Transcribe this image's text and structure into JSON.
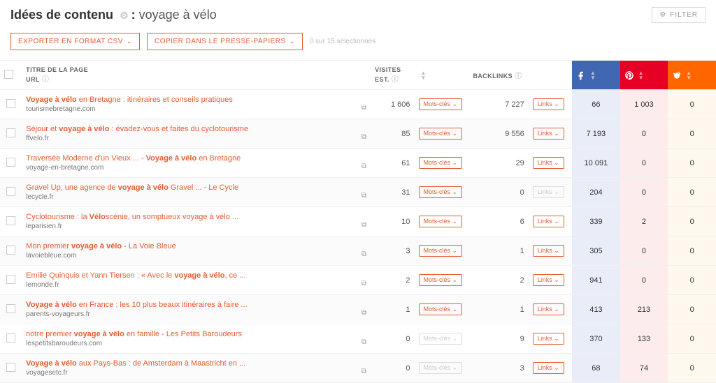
{
  "header": {
    "title_prefix": "Idées de contenu",
    "title_kw": "voyage à vélo",
    "filter": "FILTER"
  },
  "actions": {
    "export": "EXPORTER EN FORMAT CSV",
    "copy": "COPIER DANS LE PRESSE-PAPIERS",
    "selected": "0 sur 15 sélectionnés"
  },
  "columns": {
    "title": "TITRE DE LA PAGE",
    "url": "URL",
    "visits": "VISITES EST.",
    "backlinks": "BACKLINKS"
  },
  "pill": {
    "keywords": "Mots-clés",
    "links": "Links"
  },
  "rows": [
    {
      "title_pre": "",
      "title_b": "Voyage à vélo",
      "title_post": " en Bretagne : itinéraires et conseils pratiques",
      "url": "tourismebretagne.com",
      "visits": "1 606",
      "kw_enabled": true,
      "backlinks": "7 227",
      "lk_enabled": true,
      "fb": "66",
      "pt": "1 003",
      "rd": "0"
    },
    {
      "title_pre": "Séjour et ",
      "title_b": "voyage à vélo",
      "title_post": " : évadez-vous et faites du cyclotourisme",
      "url": "ffvelo.fr",
      "visits": "85",
      "kw_enabled": true,
      "backlinks": "9 556",
      "lk_enabled": true,
      "fb": "7 193",
      "pt": "0",
      "rd": "0"
    },
    {
      "title_pre": "Traversée Moderne d'un Vieux ... - ",
      "title_b": "Voyage à vélo",
      "title_post": " en Bretagne",
      "url": "voyage-en-bretagne.com",
      "visits": "61",
      "kw_enabled": true,
      "backlinks": "29",
      "lk_enabled": true,
      "fb": "10 091",
      "pt": "0",
      "rd": "0"
    },
    {
      "title_pre": "Gravel Up, une agence de ",
      "title_b": "voyage à vélo",
      "title_post": " Gravel ... - Le Cycle",
      "url": "lecycle.fr",
      "visits": "31",
      "kw_enabled": true,
      "backlinks": "0",
      "lk_enabled": false,
      "fb": "204",
      "pt": "0",
      "rd": "0"
    },
    {
      "title_pre": "Cyclotourisme : la ",
      "title_b": "Vélo",
      "title_post": "scénie, un somptueux voyage à vélo ...",
      "url": "leparisien.fr",
      "visits": "10",
      "kw_enabled": true,
      "backlinks": "6",
      "lk_enabled": true,
      "fb": "339",
      "pt": "2",
      "rd": "0"
    },
    {
      "title_pre": "Mon premier ",
      "title_b": "voyage à vélo",
      "title_post": " - La Voie Bleue",
      "url": "lavoiebleue.com",
      "visits": "3",
      "kw_enabled": true,
      "backlinks": "1",
      "lk_enabled": true,
      "fb": "305",
      "pt": "0",
      "rd": "0"
    },
    {
      "title_pre": "Emilie Quinquis et Yann Tiersen : « Avec le ",
      "title_b": "voyage à vélo",
      "title_post": ", ce ...",
      "url": "lemonde.fr",
      "visits": "2",
      "kw_enabled": true,
      "backlinks": "2",
      "lk_enabled": true,
      "fb": "941",
      "pt": "0",
      "rd": "0"
    },
    {
      "title_pre": "",
      "title_b": "Voyage à vélo",
      "title_post": " en France : les 10 plus beaux itinéraires à faire ...",
      "url": "parents-voyageurs.fr",
      "visits": "1",
      "kw_enabled": true,
      "backlinks": "1",
      "lk_enabled": true,
      "fb": "413",
      "pt": "213",
      "rd": "0"
    },
    {
      "title_pre": "notre premier ",
      "title_b": "voyage à vélo",
      "title_post": " en famille - Les Petits Baroudeurs",
      "url": "lespetitsbaroudeurs.com",
      "visits": "0",
      "kw_enabled": false,
      "backlinks": "9",
      "lk_enabled": true,
      "fb": "370",
      "pt": "133",
      "rd": "0"
    },
    {
      "title_pre": "",
      "title_b": "Voyage à vélo",
      "title_post": " aux Pays-Bas : de Amsterdam à Maastricht en ...",
      "url": "voyagesetc.fr",
      "visits": "0",
      "kw_enabled": false,
      "backlinks": "3",
      "lk_enabled": true,
      "fb": "68",
      "pt": "74",
      "rd": "0"
    }
  ]
}
